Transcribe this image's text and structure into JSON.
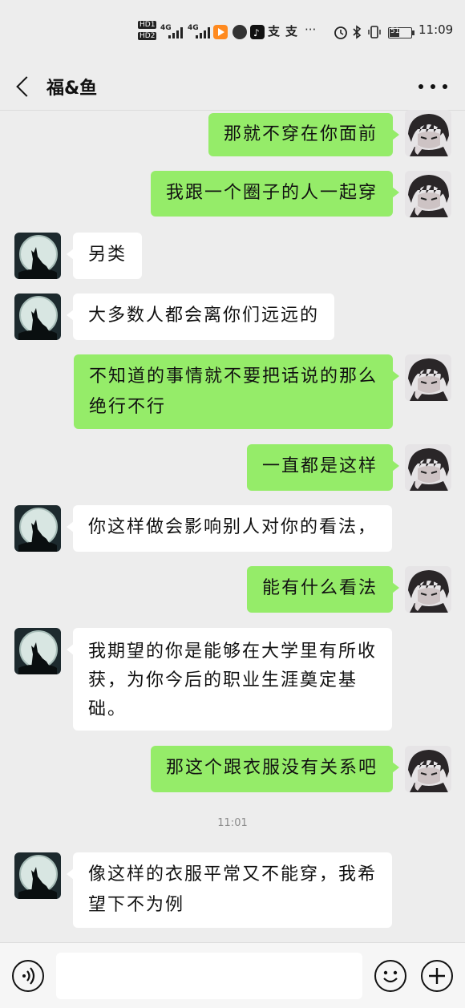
{
  "status_bar": {
    "hd1": "HD1",
    "hd2": "HD2",
    "net1": "4G",
    "net2": "4G",
    "app_icons": [
      "video-app-icon",
      "message-app-icon",
      "tiktok-icon",
      "alipay-icon",
      "alipay-icon"
    ],
    "more": "···",
    "battery_level": "51",
    "time": "11:09"
  },
  "header": {
    "back_icon": "chevron-left-icon",
    "title": "福&鱼",
    "more_icon": "more-dots-icon"
  },
  "messages": [
    {
      "side": "me",
      "text": "那就不穿在你面前"
    },
    {
      "side": "me",
      "text": "我跟一个圈子的人一起穿"
    },
    {
      "side": "other",
      "text": "另类"
    },
    {
      "side": "other",
      "text": "大多数人都会离你们远远的"
    },
    {
      "side": "me",
      "text": "不知道的事情就不要把话说的那么\n绝行不行"
    },
    {
      "side": "me",
      "text": "一直都是这样"
    },
    {
      "side": "other",
      "text": "你这样做会影响别人对你的看法，"
    },
    {
      "side": "me",
      "text": "能有什么看法"
    },
    {
      "side": "other",
      "text": "我期望的你是能够在大学里有所收\n获，为你今后的职业生涯奠定基\n础。"
    },
    {
      "side": "me",
      "text": "那这个跟衣服没有关系吧"
    },
    {
      "side": "other",
      "text": "像这样的衣服平常又不能穿，我希\n望下不为例"
    }
  ],
  "timestamp": "11:01",
  "input_bar": {
    "voice_icon": "voice-icon",
    "input_value": "",
    "emoji_icon": "emoji-icon",
    "plus_icon": "plus-icon"
  },
  "colors": {
    "background": "#ededed",
    "my_bubble": "#95ec69",
    "other_bubble": "#ffffff"
  }
}
